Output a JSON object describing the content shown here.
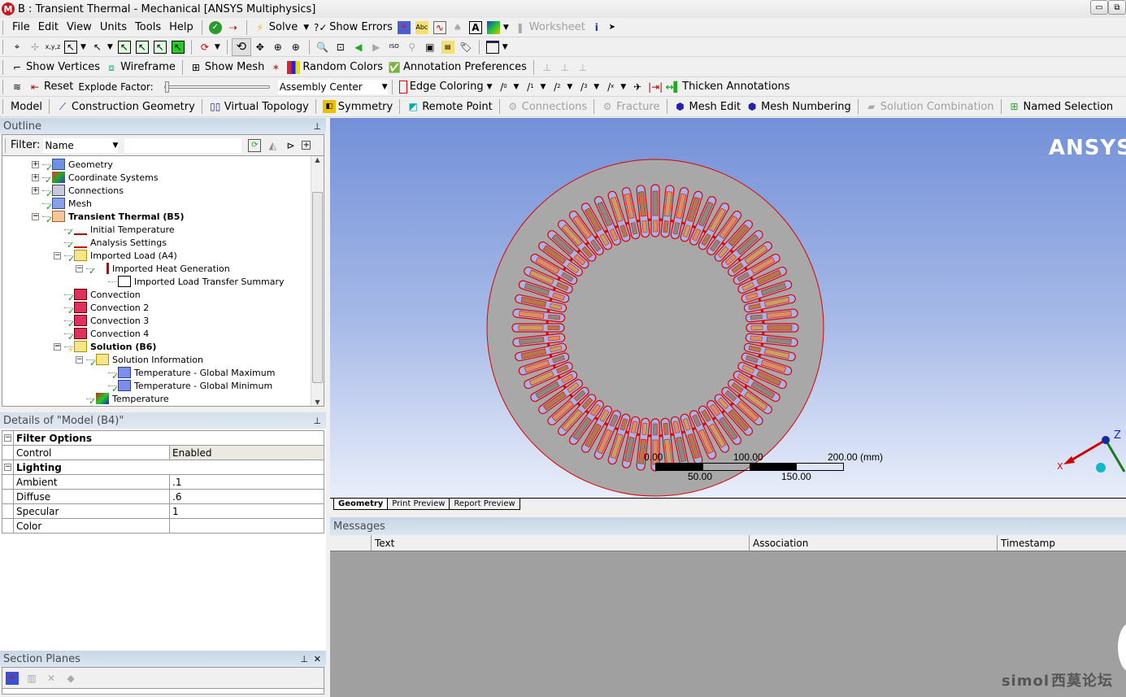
{
  "window": {
    "title": "B : Transient Thermal - Mechanical [ANSYS Multiphysics]",
    "app_icon": "M"
  },
  "menu": [
    "File",
    "Edit",
    "View",
    "Units",
    "Tools",
    "Help"
  ],
  "toolbar1": {
    "solve": "Solve",
    "show_errors": "Show Errors",
    "worksheet": "Worksheet"
  },
  "toolbar3": {
    "show_vertices": "Show Vertices",
    "wireframe": "Wireframe",
    "show_mesh": "Show Mesh",
    "random_colors": "Random Colors",
    "annotation_preferences": "Annotation Preferences"
  },
  "toolbar4": {
    "reset": "Reset",
    "explode_factor": "Explode Factor:",
    "assembly_center": "Assembly Center",
    "edge_coloring": "Edge Coloring",
    "thicken_annotations": "Thicken Annotations",
    "edge_labels": [
      "0",
      "1",
      "2",
      "3",
      "x"
    ]
  },
  "toolbar5": {
    "model": "Model",
    "construction_geometry": "Construction Geometry",
    "virtual_topology": "Virtual Topology",
    "symmetry": "Symmetry",
    "remote_point": "Remote Point",
    "connections": "Connections",
    "fracture": "Fracture",
    "mesh_edit": "Mesh Edit",
    "mesh_numbering": "Mesh Numbering",
    "solution_combination": "Solution Combination",
    "named_selection": "Named Selection"
  },
  "outline": {
    "title": "Outline",
    "filter_label": "Filter:",
    "filter_value": "Name",
    "search_value": "",
    "tree": [
      {
        "label": "Geometry",
        "level": 1,
        "expander": "+",
        "icon": "geometry-icon",
        "status": "check",
        "bold": false
      },
      {
        "label": "Coordinate Systems",
        "level": 1,
        "expander": "+",
        "icon": "coordinate-systems-icon",
        "status": "check",
        "bold": false
      },
      {
        "label": "Connections",
        "level": 1,
        "expander": "+",
        "icon": "connections-icon",
        "status": "check",
        "bold": false
      },
      {
        "label": "Mesh",
        "level": 1,
        "expander": "",
        "icon": "mesh-icon",
        "status": "check",
        "bold": false
      },
      {
        "label": "Transient Thermal (B5)",
        "level": 1,
        "expander": "-",
        "icon": "transient-thermal-icon",
        "status": "check",
        "bold": true
      },
      {
        "label": "Initial Temperature",
        "level": 2,
        "expander": "",
        "icon": "initial-temperature-icon",
        "status": "check",
        "bold": false
      },
      {
        "label": "Analysis Settings",
        "level": 2,
        "expander": "",
        "icon": "analysis-settings-icon",
        "status": "check",
        "bold": false
      },
      {
        "label": "Imported Load (A4)",
        "level": 2,
        "expander": "-",
        "icon": "imported-load-icon",
        "status": "check",
        "bold": false
      },
      {
        "label": "Imported Heat Generation",
        "level": 3,
        "expander": "-",
        "icon": "heat-generation-icon",
        "status": "check",
        "bold": false
      },
      {
        "label": "Imported Load Transfer Summary",
        "level": 4,
        "expander": "",
        "icon": "summary-icon",
        "status": "",
        "bold": false
      },
      {
        "label": "Convection",
        "level": 2,
        "expander": "",
        "icon": "convection-icon",
        "status": "check",
        "bold": false
      },
      {
        "label": "Convection 2",
        "level": 2,
        "expander": "",
        "icon": "convection-icon",
        "status": "check",
        "bold": false
      },
      {
        "label": "Convection 3",
        "level": 2,
        "expander": "",
        "icon": "convection-icon",
        "status": "check",
        "bold": false
      },
      {
        "label": "Convection 4",
        "level": 2,
        "expander": "",
        "icon": "convection-icon",
        "status": "check",
        "bold": false
      },
      {
        "label": "Solution (B6)",
        "level": 2,
        "expander": "-",
        "icon": "solution-icon",
        "status": "lightning",
        "bold": true
      },
      {
        "label": "Solution Information",
        "level": 3,
        "expander": "-",
        "icon": "solution-information-icon",
        "status": "check",
        "bold": false
      },
      {
        "label": "Temperature - Global Maximum",
        "level": 4,
        "expander": "",
        "icon": "probe-icon",
        "status": "check",
        "bold": false
      },
      {
        "label": "Temperature - Global Minimum",
        "level": 4,
        "expander": "",
        "icon": "probe-icon",
        "status": "check",
        "bold": false
      },
      {
        "label": "Temperature",
        "level": 3,
        "expander": "",
        "icon": "temperature-result-icon",
        "status": "check",
        "bold": false
      }
    ]
  },
  "details": {
    "title": "Details of \"Model (B4)\"",
    "groups": [
      {
        "name": "Filter Options",
        "rows": [
          {
            "key": "Control",
            "value": "Enabled"
          }
        ]
      },
      {
        "name": "Lighting",
        "rows": [
          {
            "key": "Ambient",
            "value": ".1"
          },
          {
            "key": "Diffuse",
            "value": ".6"
          },
          {
            "key": "Specular",
            "value": "1"
          },
          {
            "key": "Color",
            "value": ""
          }
        ]
      }
    ]
  },
  "section_planes": {
    "title": "Section Planes"
  },
  "viewport": {
    "logo": "ANSYS",
    "scale": {
      "labels_top": [
        "0.00",
        "100.00",
        "200.00 (mm)"
      ],
      "labels_bottom": [
        "50.00",
        "150.00"
      ]
    },
    "triad": {
      "x": "X",
      "z": "Z"
    },
    "colors": {
      "disc": "#a8a8a8",
      "outline": "#e00000",
      "slot_fill": "#a6b4e8"
    }
  },
  "view_tabs": [
    "Geometry",
    "Print Preview",
    "Report Preview"
  ],
  "messages": {
    "title": "Messages",
    "columns": [
      "Text",
      "Association",
      "Timestamp"
    ]
  },
  "watermark": {
    "latin": "simol",
    "cn": "西莫论坛"
  }
}
